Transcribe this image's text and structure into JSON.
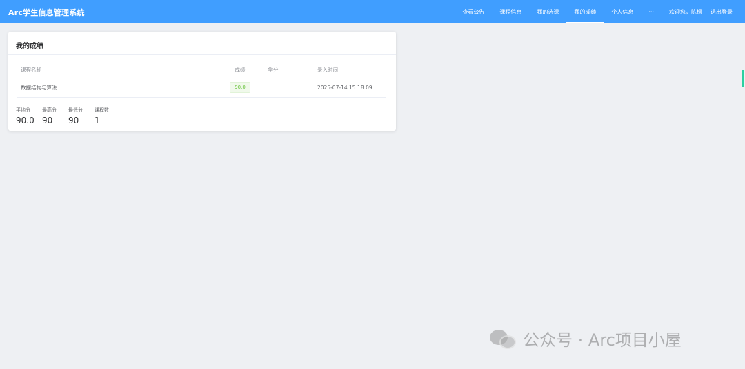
{
  "app": {
    "title": "Arc学生信息管理系统"
  },
  "nav": {
    "items": [
      {
        "label": "查看公告",
        "active": false
      },
      {
        "label": "课程信息",
        "active": false
      },
      {
        "label": "我的选课",
        "active": false
      },
      {
        "label": "我的成绩",
        "active": true
      },
      {
        "label": "个人信息",
        "active": false
      },
      {
        "label": "···",
        "active": false
      }
    ],
    "welcome": "欢迎您，陈枫",
    "logout": "退出登录"
  },
  "grades": {
    "title": "我的成绩",
    "columns": [
      "课程名称",
      "成绩",
      "学分",
      "录入时间"
    ],
    "rows": [
      {
        "course": "数据结构与算法",
        "score": "90.0",
        "credit": "",
        "time": "2025-07-14 15:18:09"
      }
    ],
    "stats": [
      {
        "label": "平均分",
        "value": "90.0"
      },
      {
        "label": "最高分",
        "value": "90"
      },
      {
        "label": "最低分",
        "value": "90"
      },
      {
        "label": "课程数",
        "value": "1"
      }
    ]
  },
  "watermark": {
    "text": "公众号 · Arc项目小屋",
    "icon": "wechat-icon"
  },
  "colors": {
    "header": "#409eff",
    "tag_text": "#67c23a",
    "tag_bg": "#f0f9eb",
    "edge_mark": "#2bd0a0"
  }
}
